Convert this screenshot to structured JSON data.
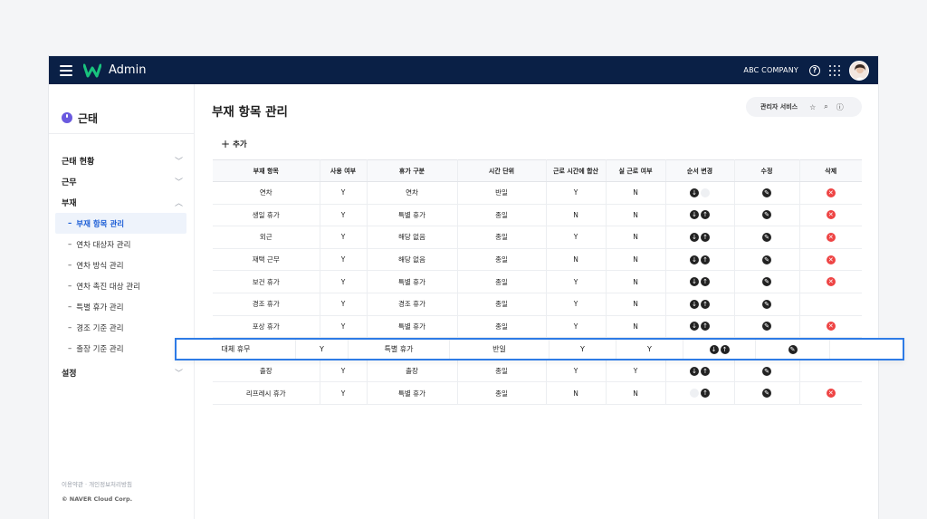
{
  "app": {
    "title": "Admin",
    "company": "ABC COMPANY"
  },
  "sidebar": {
    "title": "근태",
    "groups": [
      {
        "label": "근태 현황",
        "expanded": false
      },
      {
        "label": "근무",
        "expanded": false
      },
      {
        "label": "부재",
        "expanded": true
      },
      {
        "label": "설정",
        "expanded": false
      }
    ],
    "sub_items": [
      "부재 항목 관리",
      "연차 대상자 관리",
      "연차 방식 관리",
      "연차 촉진 대상 관리",
      "특별 휴가 관리",
      "경조 기준 관리",
      "출장 기준 관리"
    ],
    "active_sub": "부재 항목 관리",
    "footer": {
      "terms": "이용약관",
      "privacy": "개인정보처리방침",
      "copyright": "© NAVER Cloud Corp."
    }
  },
  "page": {
    "title": "부재 항목 관리",
    "admin_service_label": "관리자 서비스",
    "add_label": "추가"
  },
  "table": {
    "headers": [
      "부재 항목",
      "사용 여부",
      "휴가 구분",
      "시간 단위",
      "근로 시간에 합산",
      "실 근로 여부",
      "순서 변경",
      "수정",
      "삭제"
    ],
    "rows": [
      {
        "name": "연차",
        "use": "Y",
        "type": "연차",
        "unit": "반일",
        "sum": "Y",
        "real": "N",
        "down": true,
        "up": false,
        "delete": true
      },
      {
        "name": "생일 휴가",
        "use": "Y",
        "type": "특별 휴가",
        "unit": "종일",
        "sum": "N",
        "real": "N",
        "down": true,
        "up": true,
        "delete": true
      },
      {
        "name": "외근",
        "use": "Y",
        "type": "해당 없음",
        "unit": "종일",
        "sum": "Y",
        "real": "N",
        "down": true,
        "up": true,
        "delete": true
      },
      {
        "name": "재택 근무",
        "use": "Y",
        "type": "해당 없음",
        "unit": "종일",
        "sum": "N",
        "real": "N",
        "down": true,
        "up": true,
        "delete": true
      },
      {
        "name": "보건 휴가",
        "use": "Y",
        "type": "특별 휴가",
        "unit": "종일",
        "sum": "Y",
        "real": "N",
        "down": true,
        "up": true,
        "delete": true
      },
      {
        "name": "경조 휴가",
        "use": "Y",
        "type": "경조 휴가",
        "unit": "종일",
        "sum": "Y",
        "real": "N",
        "down": true,
        "up": true,
        "delete": false
      },
      {
        "name": "포상 휴가",
        "use": "Y",
        "type": "특별 휴가",
        "unit": "종일",
        "sum": "Y",
        "real": "N",
        "down": true,
        "up": true,
        "delete": true
      },
      {
        "name": "",
        "use": "",
        "type": "",
        "unit": "",
        "sum": "",
        "real": "",
        "down": false,
        "up": false,
        "delete": false,
        "ghost": true
      },
      {
        "name": "출장",
        "use": "Y",
        "type": "출장",
        "unit": "종일",
        "sum": "Y",
        "real": "Y",
        "down": true,
        "up": true,
        "delete": false
      },
      {
        "name": "리프레시 휴가",
        "use": "Y",
        "type": "특별 휴가",
        "unit": "종일",
        "sum": "N",
        "real": "N",
        "down": false,
        "up": true,
        "delete": true
      }
    ],
    "dragging_row": {
      "name": "대체 휴무",
      "use": "Y",
      "type": "특별 휴가",
      "unit": "반일",
      "sum": "Y",
      "real": "Y"
    }
  },
  "colors": {
    "topbar": "#0a2046",
    "accent": "#2e7be6",
    "delete": "#ee4444",
    "active_menu": "#1e5fd6"
  },
  "icons": {
    "menu": "hamburger-icon",
    "help": "question-icon",
    "apps": "grid-icon",
    "favorite": "star-icon",
    "search": "search-icon",
    "info": "info-icon",
    "edit": "pencil-icon",
    "delete": "delete-icon",
    "down": "arrow-down-icon",
    "up": "arrow-up-icon"
  }
}
